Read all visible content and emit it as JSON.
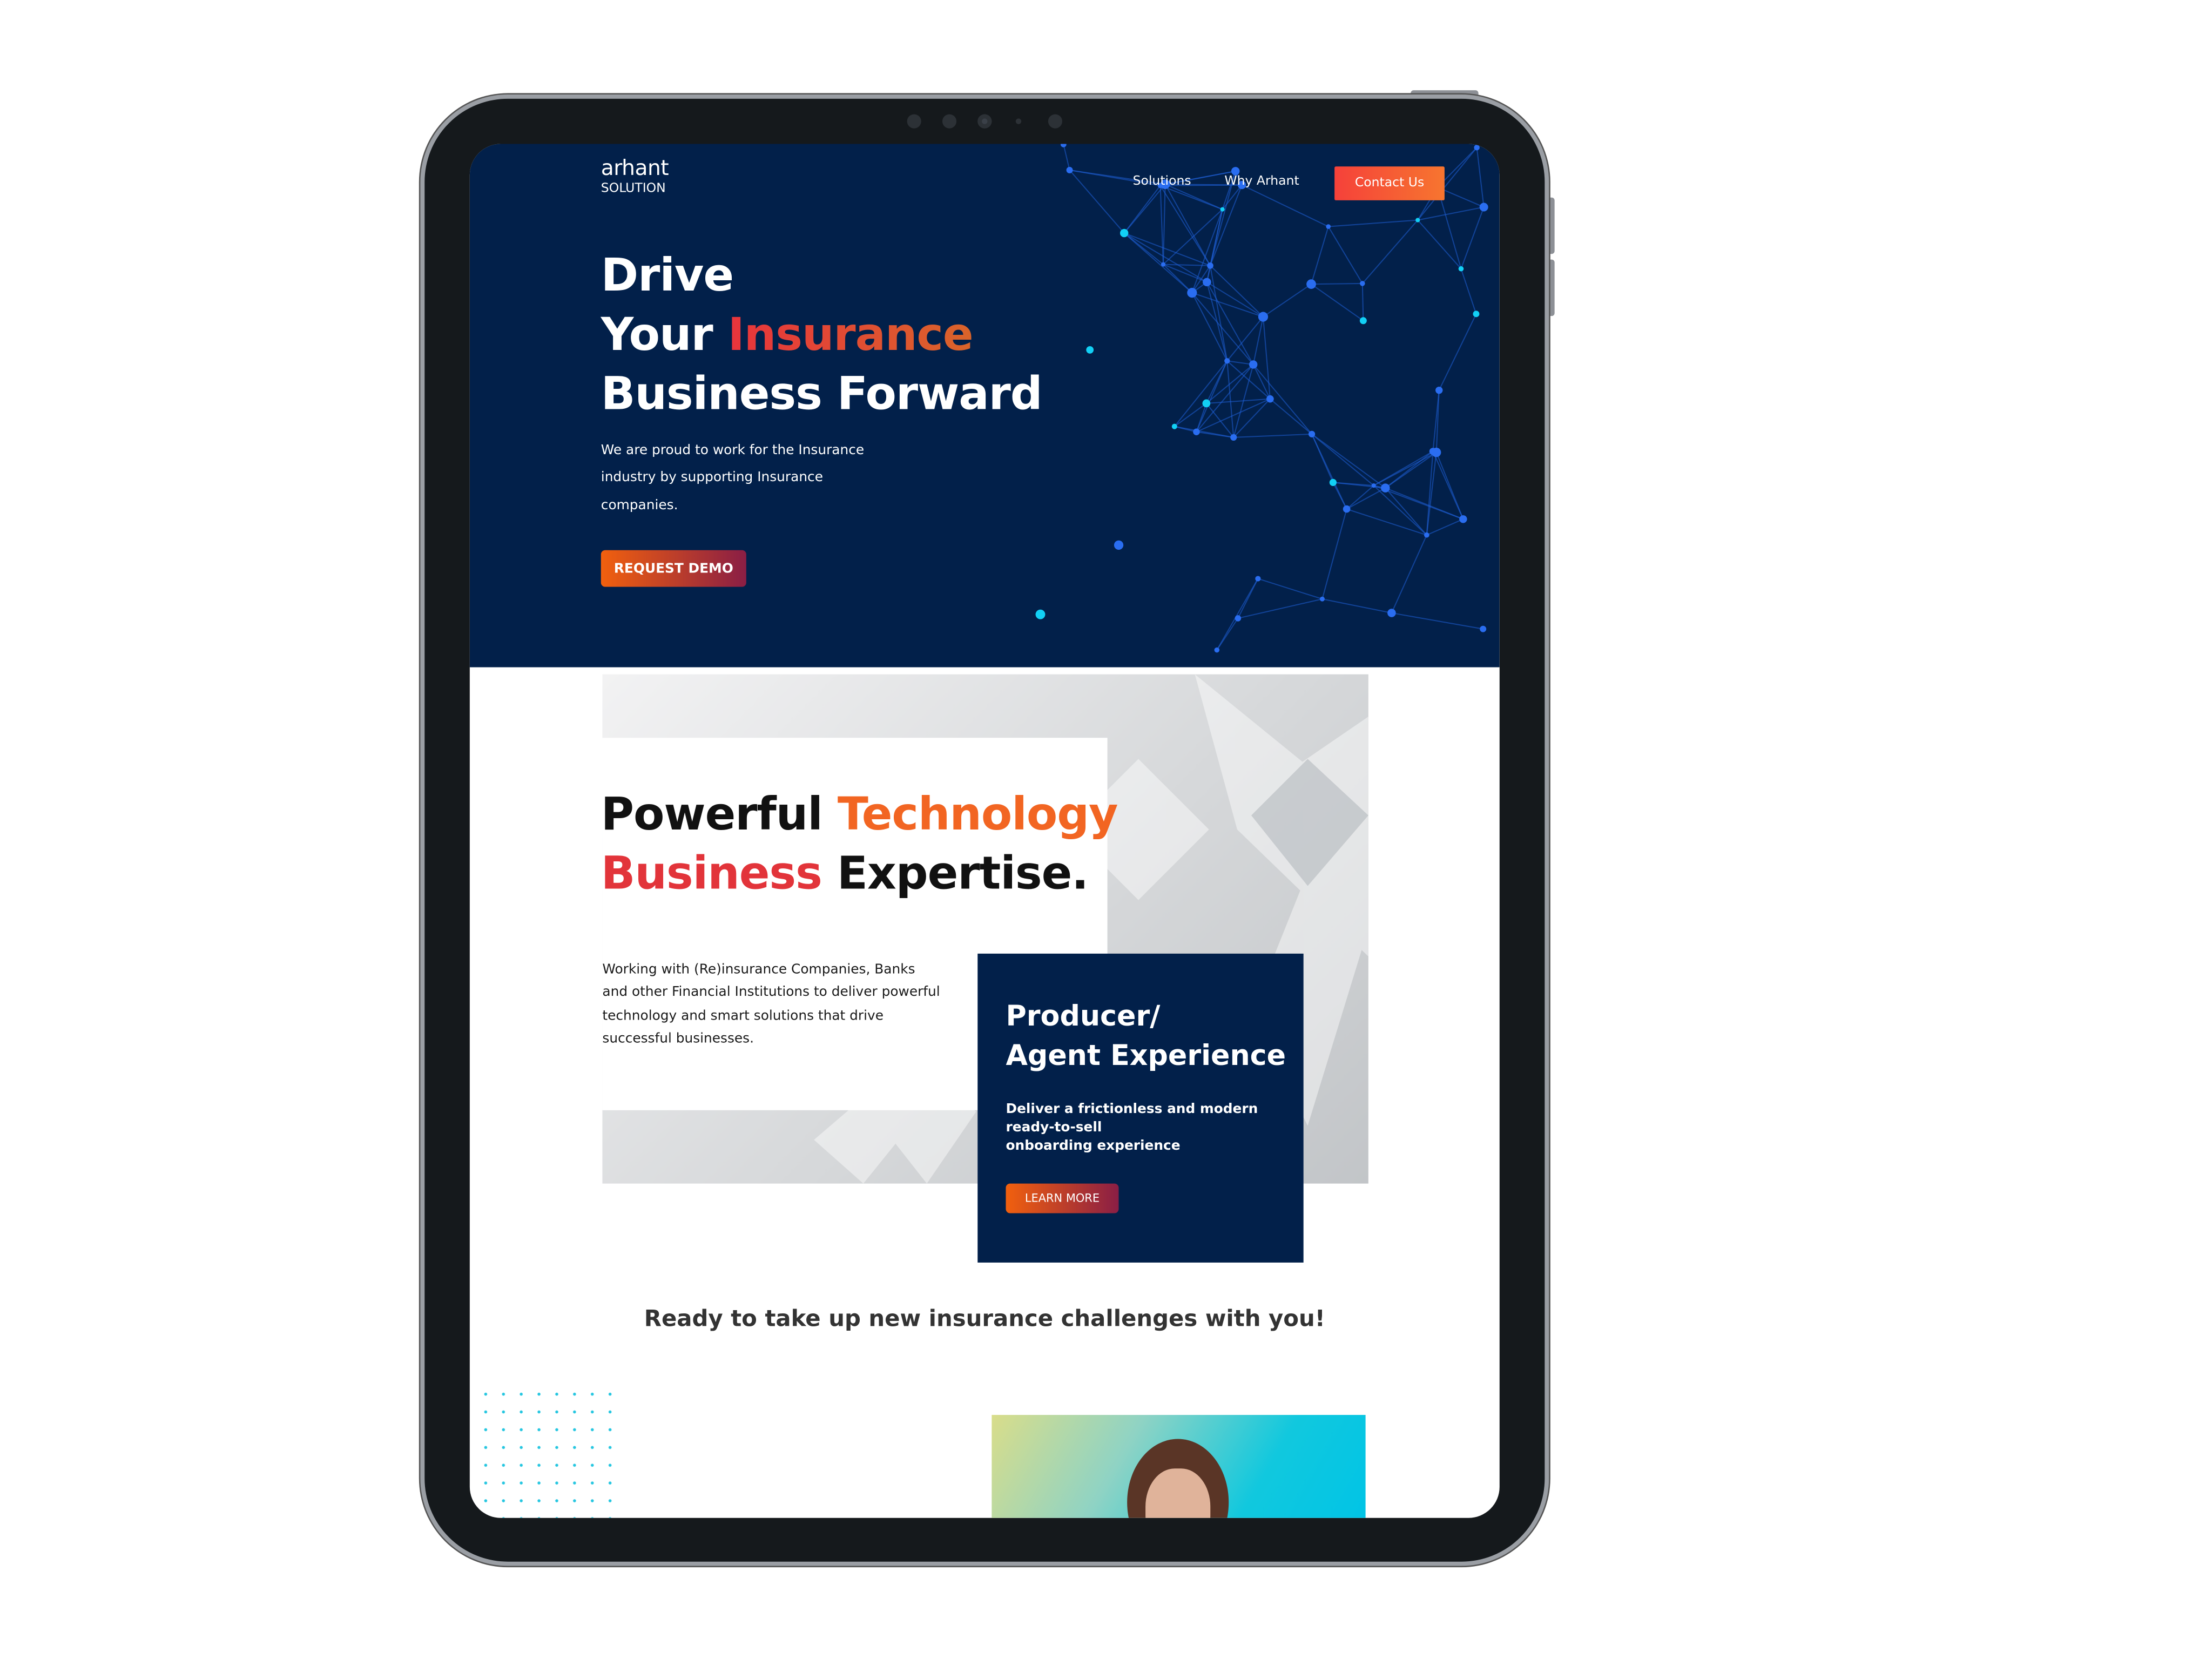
{
  "logo": {
    "name": "arhant",
    "sub": "SOLUTION"
  },
  "nav": {
    "items": [
      "Solutions",
      "Why Arhant"
    ],
    "contact": "Contact Us"
  },
  "hero": {
    "line1": "Drive",
    "line2a": "Your ",
    "line2b": "Insurance",
    "line3": "Business Forward",
    "text": "We are proud to work for the Insurance industry by supporting Insurance companies.",
    "button": "REQUEST DEMO"
  },
  "section": {
    "h_a": "Powerful ",
    "h_b": "Technology",
    "h_c": "Business",
    "h_d": " Expertise.",
    "text": "Working with (Re)insurance Companies, Banks and other Financial Institutions to deliver powerful technology and smart solutions that drive successful businesses."
  },
  "card": {
    "title1": "Producer/",
    "title2": "Agent Experience",
    "text1": "Deliver a frictionless and modern",
    "text2": "ready-to-sell",
    "text3": "onboarding experience",
    "button": "LEARN MORE"
  },
  "tagline": "Ready to take up new insurance challenges with you!",
  "colors": {
    "navy": "#02204a",
    "accent": "#f5413a",
    "orange": "#f1600e"
  }
}
